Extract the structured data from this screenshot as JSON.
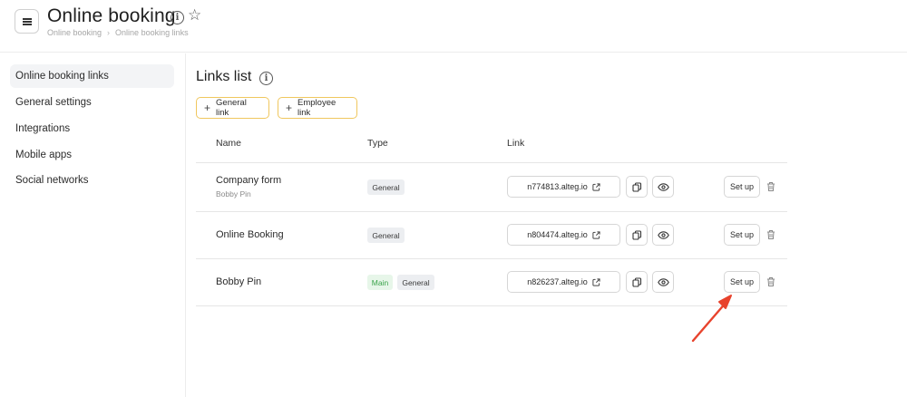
{
  "header": {
    "title": "Online booking",
    "breadcrumb": [
      "Online booking",
      "Online booking links"
    ]
  },
  "sidebar": {
    "items": [
      {
        "label": "Online booking links",
        "active": true
      },
      {
        "label": "General settings",
        "active": false
      },
      {
        "label": "Integrations",
        "active": false
      },
      {
        "label": "Mobile apps",
        "active": false
      },
      {
        "label": "Social networks",
        "active": false
      }
    ]
  },
  "main": {
    "section_title": "Links list",
    "add_buttons": {
      "general": "General link",
      "employee": "Employee link"
    },
    "columns": {
      "name": "Name",
      "type": "Type",
      "link": "Link"
    },
    "rows": [
      {
        "name": "Company form",
        "subtitle": "Bobby Pin",
        "types": [
          "General"
        ],
        "link": "n774813.alteg.io",
        "setup_label": "Set up"
      },
      {
        "name": "Online Booking",
        "subtitle": "",
        "types": [
          "General"
        ],
        "link": "n804474.alteg.io",
        "setup_label": "Set up"
      },
      {
        "name": "Bobby Pin",
        "subtitle": "",
        "types": [
          "Main",
          "General"
        ],
        "link": "n826237.alteg.io",
        "setup_label": "Set up"
      }
    ]
  },
  "colors": {
    "accent_border": "#f0c75e",
    "main_badge_text": "#3aa34a",
    "annotation_arrow": "#e8432d"
  },
  "icons": [
    "menu-icon",
    "info-icon",
    "star-icon",
    "plus-icon",
    "external-link-icon",
    "copy-icon",
    "eye-icon",
    "trash-icon"
  ]
}
